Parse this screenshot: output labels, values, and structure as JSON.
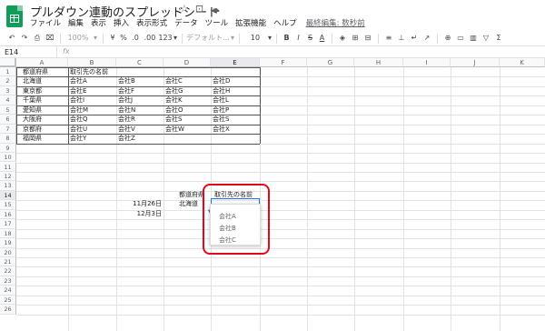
{
  "title": "プルダウン連動のスプレッドシート",
  "title_icons": [
    "☆",
    "⊡",
    "☁"
  ],
  "menu": [
    "ファイル",
    "編集",
    "表示",
    "挿入",
    "表示形式",
    "データ",
    "ツール",
    "拡張機能",
    "ヘルプ"
  ],
  "last_edit": "最終編集: 数秒前",
  "toolbar": {
    "zoom": "100%",
    "currency": "¥",
    "percent": "%",
    "decrease_decimal": ".0",
    "increase_decimal": ".00",
    "number_format": "123",
    "font": "デフォルト...",
    "font_size": "10",
    "bold": "B",
    "italic": "I",
    "strike": "S",
    "text_color": "A"
  },
  "name_box": "E14",
  "fx": "fx",
  "columns": [
    "A",
    "B",
    "C",
    "D",
    "E",
    "F",
    "G",
    "H",
    "I",
    "J",
    "K"
  ],
  "selected_column": "E",
  "rows": [
    "1",
    "2",
    "3",
    "4",
    "5",
    "6",
    "7",
    "8",
    "9",
    "10",
    "11",
    "12",
    "13",
    "14",
    "15",
    "16",
    "17",
    "18",
    "19",
    "20",
    "21",
    "22",
    "23",
    "24",
    "25",
    "26"
  ],
  "selected_row": "14",
  "table": {
    "headers": [
      "都道府県",
      "取引先の名前"
    ],
    "rows": [
      [
        "北海道",
        "会社A",
        "会社B",
        "会社C",
        "会社D"
      ],
      [
        "東京都",
        "会社E",
        "会社F",
        "会社G",
        "会社H"
      ],
      [
        "千葉県",
        "会社I",
        "会社J",
        "会社K",
        "会社L"
      ],
      [
        "愛知県",
        "会社M",
        "会社N",
        "会社O",
        "会社P"
      ],
      [
        "大阪府",
        "会社Q",
        "会社R",
        "会社S",
        "会社S"
      ],
      [
        "京都府",
        "会社U",
        "会社V",
        "会社W",
        "会社X"
      ],
      [
        "福岡県",
        "会社Y",
        "会社Z",
        "",
        ""
      ]
    ]
  },
  "lookup": {
    "header_pref": "都道府県",
    "header_name": "取引先の名前",
    "date1": "11月26日",
    "date2": "12月3日",
    "pref_value": "北海道"
  },
  "dropdown_options": [
    "会社A",
    "会社B",
    "会社C"
  ],
  "colors": {
    "sheets_green": "#0f9d58",
    "selection_blue": "#1a73e8",
    "highlight_red": "#e0091a"
  }
}
